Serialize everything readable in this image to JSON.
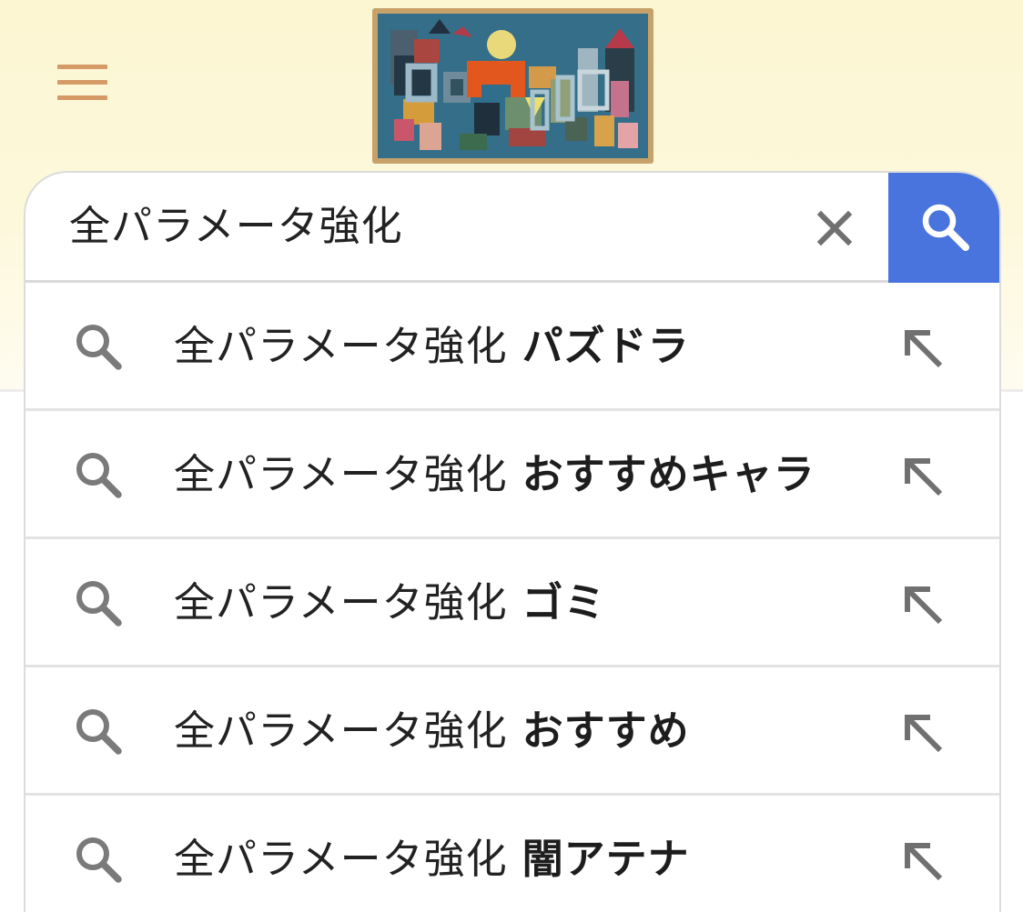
{
  "header": {
    "menu_icon": "hamburger-menu-icon",
    "doodle_icon": "google-doodle-logo",
    "doodle_colors": [
      "#2f6f8c",
      "#e2571e",
      "#3c6b4e",
      "#b8415a",
      "#d8a24a",
      "#e8df7a",
      "#24333f"
    ]
  },
  "search": {
    "query": "全パラメータ強化",
    "clear_icon": "close-icon",
    "submit_icon": "search-icon",
    "accent_color": "#4a74dd"
  },
  "suggestions": [
    {
      "prefix": "全パラメータ強化",
      "completion": "パズドラ",
      "icon": "search-icon",
      "action_icon": "arrow-up-left-icon"
    },
    {
      "prefix": "全パラメータ強化",
      "completion": "おすすめキャラ",
      "icon": "search-icon",
      "action_icon": "arrow-up-left-icon"
    },
    {
      "prefix": "全パラメータ強化",
      "completion": "ゴミ",
      "icon": "search-icon",
      "action_icon": "arrow-up-left-icon"
    },
    {
      "prefix": "全パラメータ強化",
      "completion": "おすすめ",
      "icon": "search-icon",
      "action_icon": "arrow-up-left-icon"
    },
    {
      "prefix": "全パラメータ強化",
      "completion": "闇アテナ",
      "icon": "search-icon",
      "action_icon": "arrow-up-left-icon"
    }
  ]
}
